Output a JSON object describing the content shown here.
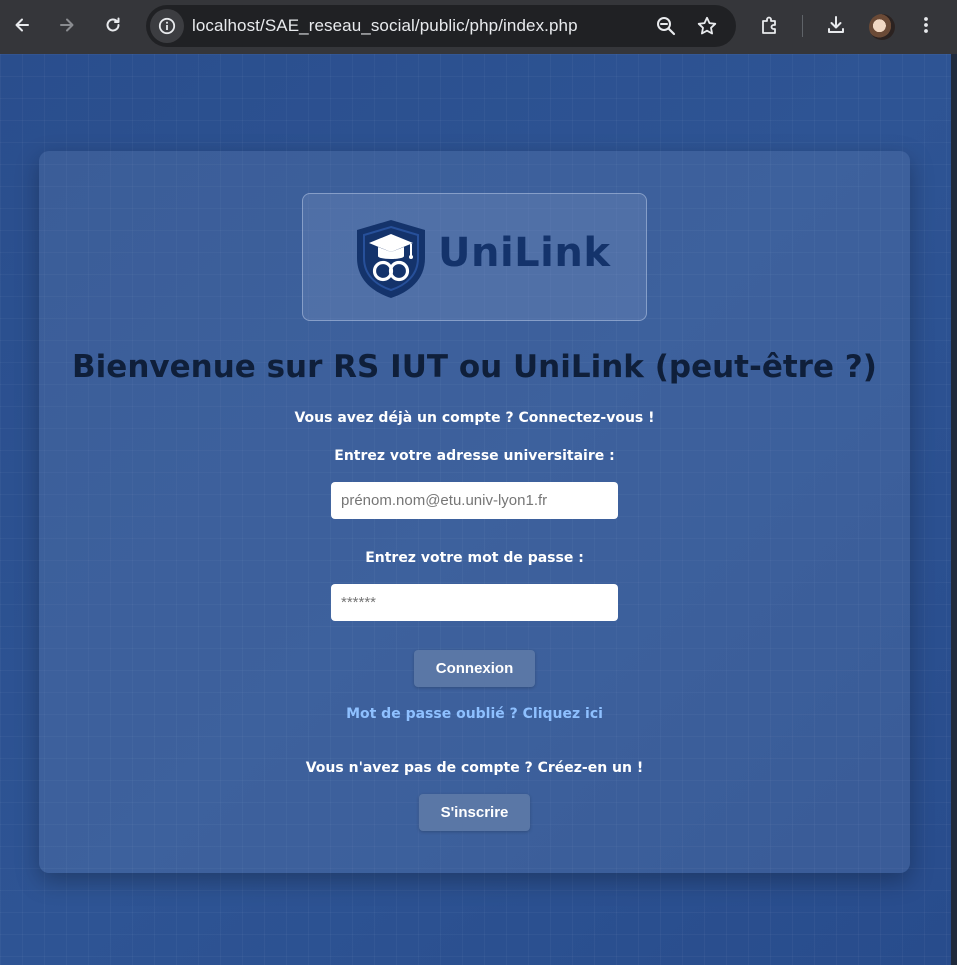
{
  "browser": {
    "url": "localhost/SAE_reseau_social/public/php/index.php"
  },
  "logo": {
    "text": "UniLink"
  },
  "login": {
    "title": "Bienvenue sur RS IUT ou UniLink (peut-être ?)",
    "have_account": "Vous avez déjà un compte ? Connectez-vous !",
    "email_label": "Entrez votre adresse universitaire :",
    "email_placeholder": "prénom.nom@etu.univ-lyon1.fr",
    "password_label": "Entrez votre mot de passe :",
    "password_placeholder": "******",
    "submit_label": "Connexion",
    "forgot_link": "Mot de passe oublié ? Cliquez ici",
    "no_account": "Vous n'avez pas de compte ? Créez-en un !",
    "signup_label": "S'inscrire"
  },
  "colors": {
    "background": "#274b8a",
    "button": "#5a77a6",
    "link": "#8ec0ff",
    "title": "#0f1f3a",
    "logo": "#14336b"
  }
}
